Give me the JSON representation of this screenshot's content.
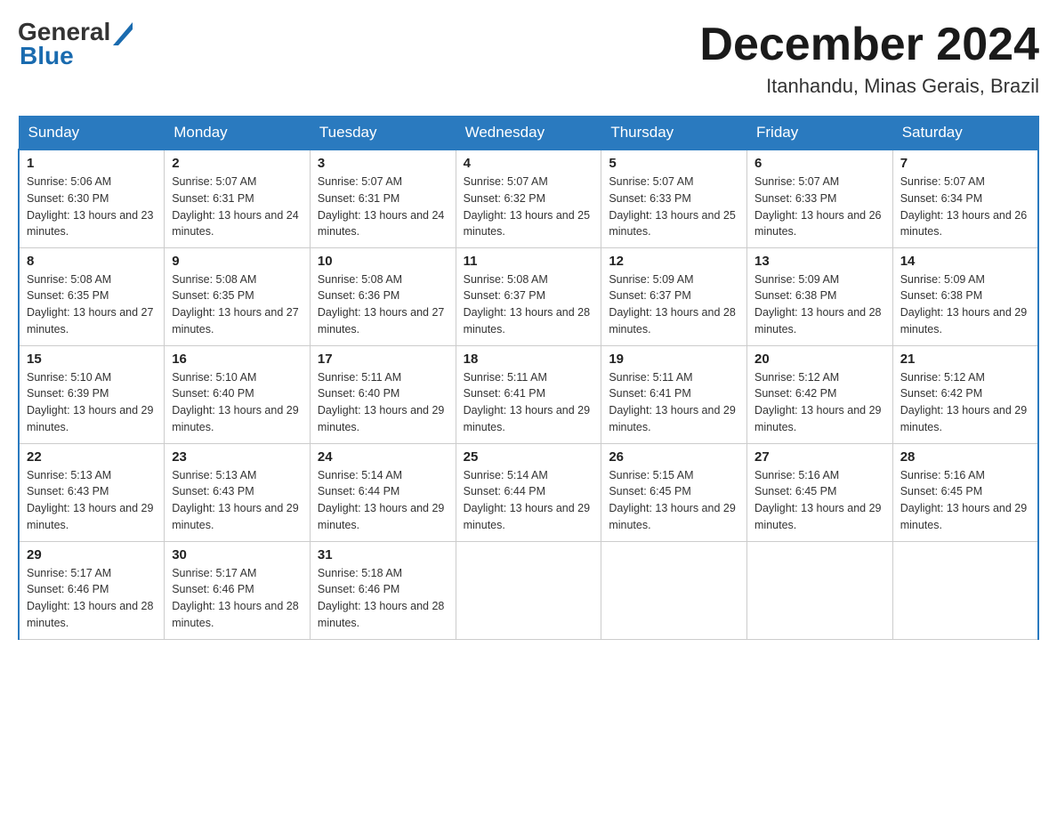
{
  "header": {
    "logo_general": "General",
    "logo_blue": "Blue",
    "month_year": "December 2024",
    "location": "Itanhandu, Minas Gerais, Brazil"
  },
  "calendar": {
    "days_of_week": [
      "Sunday",
      "Monday",
      "Tuesday",
      "Wednesday",
      "Thursday",
      "Friday",
      "Saturday"
    ],
    "weeks": [
      [
        {
          "day": "1",
          "sunrise": "5:06 AM",
          "sunset": "6:30 PM",
          "daylight": "13 hours and 23 minutes."
        },
        {
          "day": "2",
          "sunrise": "5:07 AM",
          "sunset": "6:31 PM",
          "daylight": "13 hours and 24 minutes."
        },
        {
          "day": "3",
          "sunrise": "5:07 AM",
          "sunset": "6:31 PM",
          "daylight": "13 hours and 24 minutes."
        },
        {
          "day": "4",
          "sunrise": "5:07 AM",
          "sunset": "6:32 PM",
          "daylight": "13 hours and 25 minutes."
        },
        {
          "day": "5",
          "sunrise": "5:07 AM",
          "sunset": "6:33 PM",
          "daylight": "13 hours and 25 minutes."
        },
        {
          "day": "6",
          "sunrise": "5:07 AM",
          "sunset": "6:33 PM",
          "daylight": "13 hours and 26 minutes."
        },
        {
          "day": "7",
          "sunrise": "5:07 AM",
          "sunset": "6:34 PM",
          "daylight": "13 hours and 26 minutes."
        }
      ],
      [
        {
          "day": "8",
          "sunrise": "5:08 AM",
          "sunset": "6:35 PM",
          "daylight": "13 hours and 27 minutes."
        },
        {
          "day": "9",
          "sunrise": "5:08 AM",
          "sunset": "6:35 PM",
          "daylight": "13 hours and 27 minutes."
        },
        {
          "day": "10",
          "sunrise": "5:08 AM",
          "sunset": "6:36 PM",
          "daylight": "13 hours and 27 minutes."
        },
        {
          "day": "11",
          "sunrise": "5:08 AM",
          "sunset": "6:37 PM",
          "daylight": "13 hours and 28 minutes."
        },
        {
          "day": "12",
          "sunrise": "5:09 AM",
          "sunset": "6:37 PM",
          "daylight": "13 hours and 28 minutes."
        },
        {
          "day": "13",
          "sunrise": "5:09 AM",
          "sunset": "6:38 PM",
          "daylight": "13 hours and 28 minutes."
        },
        {
          "day": "14",
          "sunrise": "5:09 AM",
          "sunset": "6:38 PM",
          "daylight": "13 hours and 29 minutes."
        }
      ],
      [
        {
          "day": "15",
          "sunrise": "5:10 AM",
          "sunset": "6:39 PM",
          "daylight": "13 hours and 29 minutes."
        },
        {
          "day": "16",
          "sunrise": "5:10 AM",
          "sunset": "6:40 PM",
          "daylight": "13 hours and 29 minutes."
        },
        {
          "day": "17",
          "sunrise": "5:11 AM",
          "sunset": "6:40 PM",
          "daylight": "13 hours and 29 minutes."
        },
        {
          "day": "18",
          "sunrise": "5:11 AM",
          "sunset": "6:41 PM",
          "daylight": "13 hours and 29 minutes."
        },
        {
          "day": "19",
          "sunrise": "5:11 AM",
          "sunset": "6:41 PM",
          "daylight": "13 hours and 29 minutes."
        },
        {
          "day": "20",
          "sunrise": "5:12 AM",
          "sunset": "6:42 PM",
          "daylight": "13 hours and 29 minutes."
        },
        {
          "day": "21",
          "sunrise": "5:12 AM",
          "sunset": "6:42 PM",
          "daylight": "13 hours and 29 minutes."
        }
      ],
      [
        {
          "day": "22",
          "sunrise": "5:13 AM",
          "sunset": "6:43 PM",
          "daylight": "13 hours and 29 minutes."
        },
        {
          "day": "23",
          "sunrise": "5:13 AM",
          "sunset": "6:43 PM",
          "daylight": "13 hours and 29 minutes."
        },
        {
          "day": "24",
          "sunrise": "5:14 AM",
          "sunset": "6:44 PM",
          "daylight": "13 hours and 29 minutes."
        },
        {
          "day": "25",
          "sunrise": "5:14 AM",
          "sunset": "6:44 PM",
          "daylight": "13 hours and 29 minutes."
        },
        {
          "day": "26",
          "sunrise": "5:15 AM",
          "sunset": "6:45 PM",
          "daylight": "13 hours and 29 minutes."
        },
        {
          "day": "27",
          "sunrise": "5:16 AM",
          "sunset": "6:45 PM",
          "daylight": "13 hours and 29 minutes."
        },
        {
          "day": "28",
          "sunrise": "5:16 AM",
          "sunset": "6:45 PM",
          "daylight": "13 hours and 29 minutes."
        }
      ],
      [
        {
          "day": "29",
          "sunrise": "5:17 AM",
          "sunset": "6:46 PM",
          "daylight": "13 hours and 28 minutes."
        },
        {
          "day": "30",
          "sunrise": "5:17 AM",
          "sunset": "6:46 PM",
          "daylight": "13 hours and 28 minutes."
        },
        {
          "day": "31",
          "sunrise": "5:18 AM",
          "sunset": "6:46 PM",
          "daylight": "13 hours and 28 minutes."
        },
        null,
        null,
        null,
        null
      ]
    ]
  }
}
